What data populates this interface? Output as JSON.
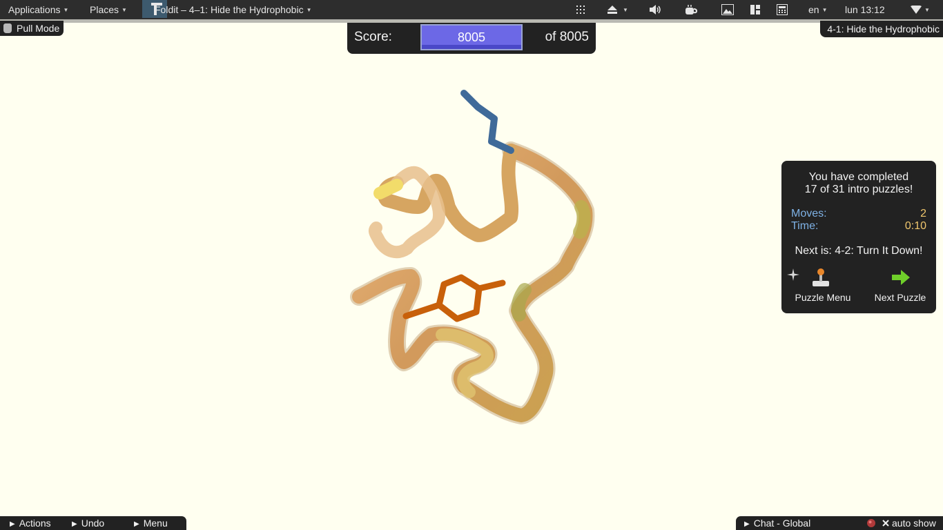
{
  "top_panel": {
    "applications": "Applications",
    "places": "Places",
    "window_title": "Foldit – 4–1: Hide the Hydrophobic",
    "language": "en",
    "clock": "lun 13:12"
  },
  "toolbar": {
    "mode_label": "Pull Mode",
    "puzzle_name": "4-1: Hide the Hydrophobic"
  },
  "score": {
    "label": "Score:",
    "value": "8005",
    "max_label": "of 8005"
  },
  "completion": {
    "line1": "You have completed",
    "line2": "17 of 31 intro puzzles!",
    "moves_label": "Moves:",
    "moves_value": "2",
    "time_label": "Time:",
    "time_value": "0:10",
    "next_is": "Next is: 4-2: Turn It Down!",
    "puzzle_menu": "Puzzle Menu",
    "next_puzzle": "Next Puzzle"
  },
  "bottom_left": {
    "actions": "Actions",
    "undo": "Undo",
    "menu": "Menu"
  },
  "bottom_right": {
    "chat": "Chat - Global",
    "auto_show": "auto show"
  },
  "colors": {
    "background": "#fffff0",
    "panel": "#222222",
    "score_fill": "#6c68e6",
    "stat_label": "#7fb2e6",
    "stat_value": "#f0c76e",
    "backbone": "#d9a466",
    "sidechain": "#c8600a",
    "terminus": "#3f6a99"
  }
}
